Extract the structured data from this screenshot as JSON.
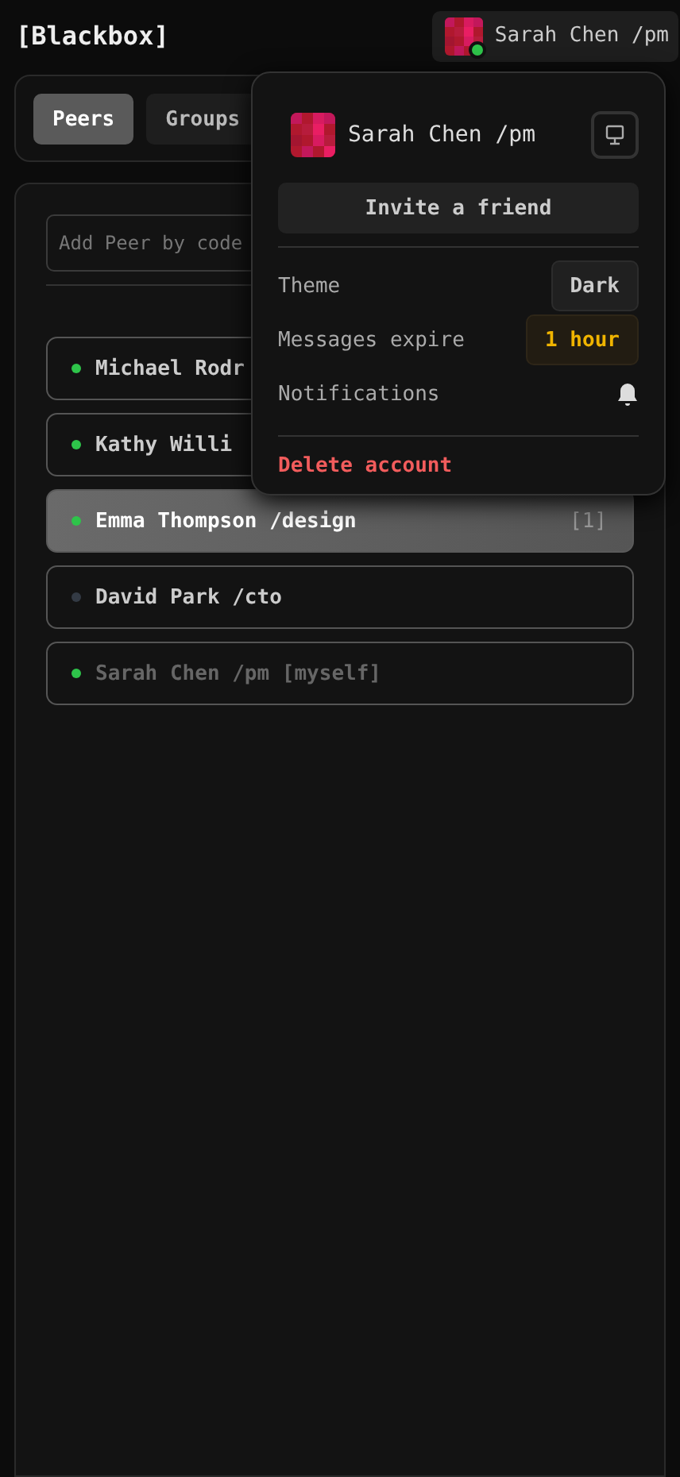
{
  "app_title": "[Blackbox]",
  "account_button": {
    "name": "Sarah Chen /pm",
    "online": true
  },
  "tabs": [
    {
      "label": "Peers",
      "selected": true
    },
    {
      "label": "Groups",
      "selected": false
    }
  ],
  "add_peer": {
    "placeholder": "Add Peer by code"
  },
  "peers": [
    {
      "name": "Michael Rodr",
      "online": true,
      "selected": false,
      "self": false
    },
    {
      "name": "Kathy Willi",
      "online": true,
      "selected": false,
      "self": false
    },
    {
      "name": "Emma Thompson /design",
      "online": true,
      "selected": true,
      "self": false,
      "unread": "[1]"
    },
    {
      "name": "David Park /cto",
      "online": false,
      "selected": false,
      "self": false
    },
    {
      "name": "Sarah Chen /pm [myself]",
      "online": true,
      "selected": false,
      "self": true
    }
  ],
  "menu": {
    "name": "Sarah Chen /pm",
    "invite": "Invite a friend",
    "settings": [
      {
        "kind": "button",
        "label": "Theme",
        "value": "Dark"
      },
      {
        "kind": "highlight",
        "label": "Messages expire",
        "value": "1 hour"
      },
      {
        "kind": "bell",
        "label": "Notifications"
      }
    ],
    "delete": "Delete account"
  }
}
